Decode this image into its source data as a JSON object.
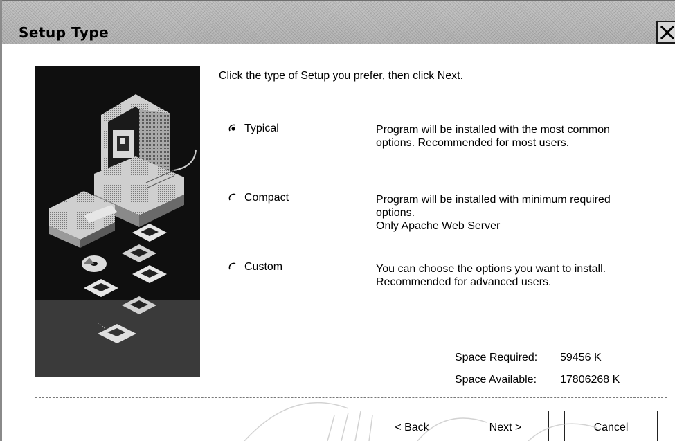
{
  "window": {
    "title": "Setup Type"
  },
  "icons": {
    "close": "close-icon",
    "art": "computer-setup-illustration"
  },
  "instruction": "Click the type of Setup you prefer, then click Next.",
  "options": [
    {
      "label": "Typical",
      "selected": true,
      "description": [
        "Program will be installed with the most common",
        "options. Recommended for most users."
      ]
    },
    {
      "label": "Compact",
      "selected": false,
      "description": [
        "Program will be installed with minimum required",
        "options.",
        "Only Apache Web Server"
      ]
    },
    {
      "label": "Custom",
      "selected": false,
      "description": [
        "You can choose the options you want to install.",
        "Recommended for advanced users."
      ]
    }
  ],
  "space": {
    "required_label": "Space Required:",
    "required_value": "59456 K",
    "available_label": "Space Available:",
    "available_value": "17806268 K"
  },
  "buttons": {
    "back": "< Back",
    "next": "Next >",
    "cancel": "Cancel"
  }
}
